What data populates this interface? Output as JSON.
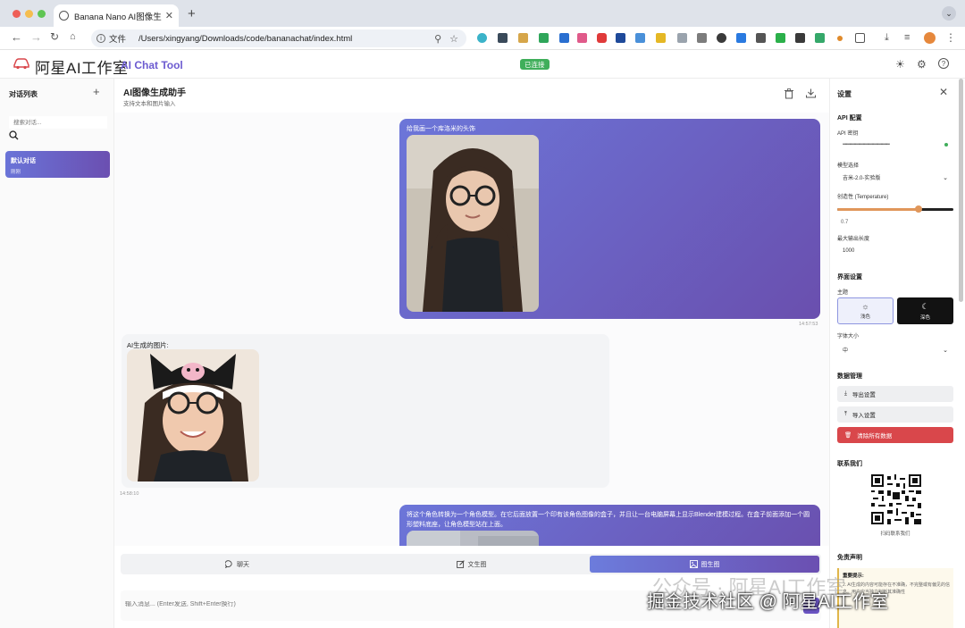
{
  "browser": {
    "tab_title": "Banana Nano AI图像生成聊天",
    "address_label": "文件",
    "url": "/Users/xingyang/Downloads/code/bananachat/index.html"
  },
  "header": {
    "logo_cn": "阿星AI工作室",
    "logo_en": "AI Chat Tool",
    "status": "已连接"
  },
  "sidebar": {
    "title": "对话列表",
    "search_placeholder": "搜索对话...",
    "conversations": [
      {
        "name": "默认对话",
        "time": "刚刚"
      }
    ]
  },
  "chat": {
    "title": "AI图像生成助手",
    "subtitle": "支持文本和图片输入",
    "messages": [
      {
        "role": "user",
        "text": "给我画一个库洛米的头饰",
        "time": "14:57:53"
      },
      {
        "role": "ai",
        "text": "AI生成的图片:",
        "time": "14:58:10"
      },
      {
        "role": "user",
        "text": "将这个角色转换为一个角色模型。在它后面放置一个印有该角色图像的盒子，并且让一台电脑屏幕上显示Blender建模过程。在盒子前面添加一个圆形塑料底座，让角色模型站在上面。"
      }
    ],
    "modes": [
      "聊天",
      "文生图",
      "图生图"
    ],
    "active_mode": "图生图",
    "input_placeholder": "输入消息... (Enter发送, Shift+Enter换行)"
  },
  "settings": {
    "title": "设置",
    "api_section": "API 配置",
    "api_key_label": "API 密钥",
    "api_key_value": "••••••••••••••••••••••••••••••••••••••••••",
    "model_label": "模型选择",
    "model_value": "吉米-2.0-实验版",
    "temperature_label": "创造性 (Temperature)",
    "temperature_value": "0.7",
    "temperature_fraction": 0.7,
    "max_tokens_label": "最大输出长度",
    "max_tokens_value": "1000",
    "ui_section": "界面设置",
    "theme_label": "主题",
    "theme_light": "浅色",
    "theme_dark": "深色",
    "font_size_label": "字体大小",
    "font_size_value": "中",
    "data_section": "数据管理",
    "export_label": "导出设置",
    "import_label": "导入设置",
    "clear_label": "清除所有数据",
    "contact_section": "联系我们",
    "qr_caption": "扫码联系我们",
    "disclaimer_section": "免责声明",
    "disclaimer_heading": "重要提示:",
    "disclaimer_body": "2. AI生成的内容可能存在不准确，不完整或有偏见的信息。用户应当独立判断其准确性"
  },
  "watermark": {
    "line1": "公众号 · 阿星AI工作室",
    "line2": "掘金技术社区 @ 阿星AI工作室"
  },
  "colors": {
    "accent": "#6c5bd0",
    "gradient_start": "#6c76d9",
    "gradient_end": "#6a4fae",
    "success": "#3fae5a",
    "danger": "#d9474b",
    "slider": "#e0965a"
  }
}
